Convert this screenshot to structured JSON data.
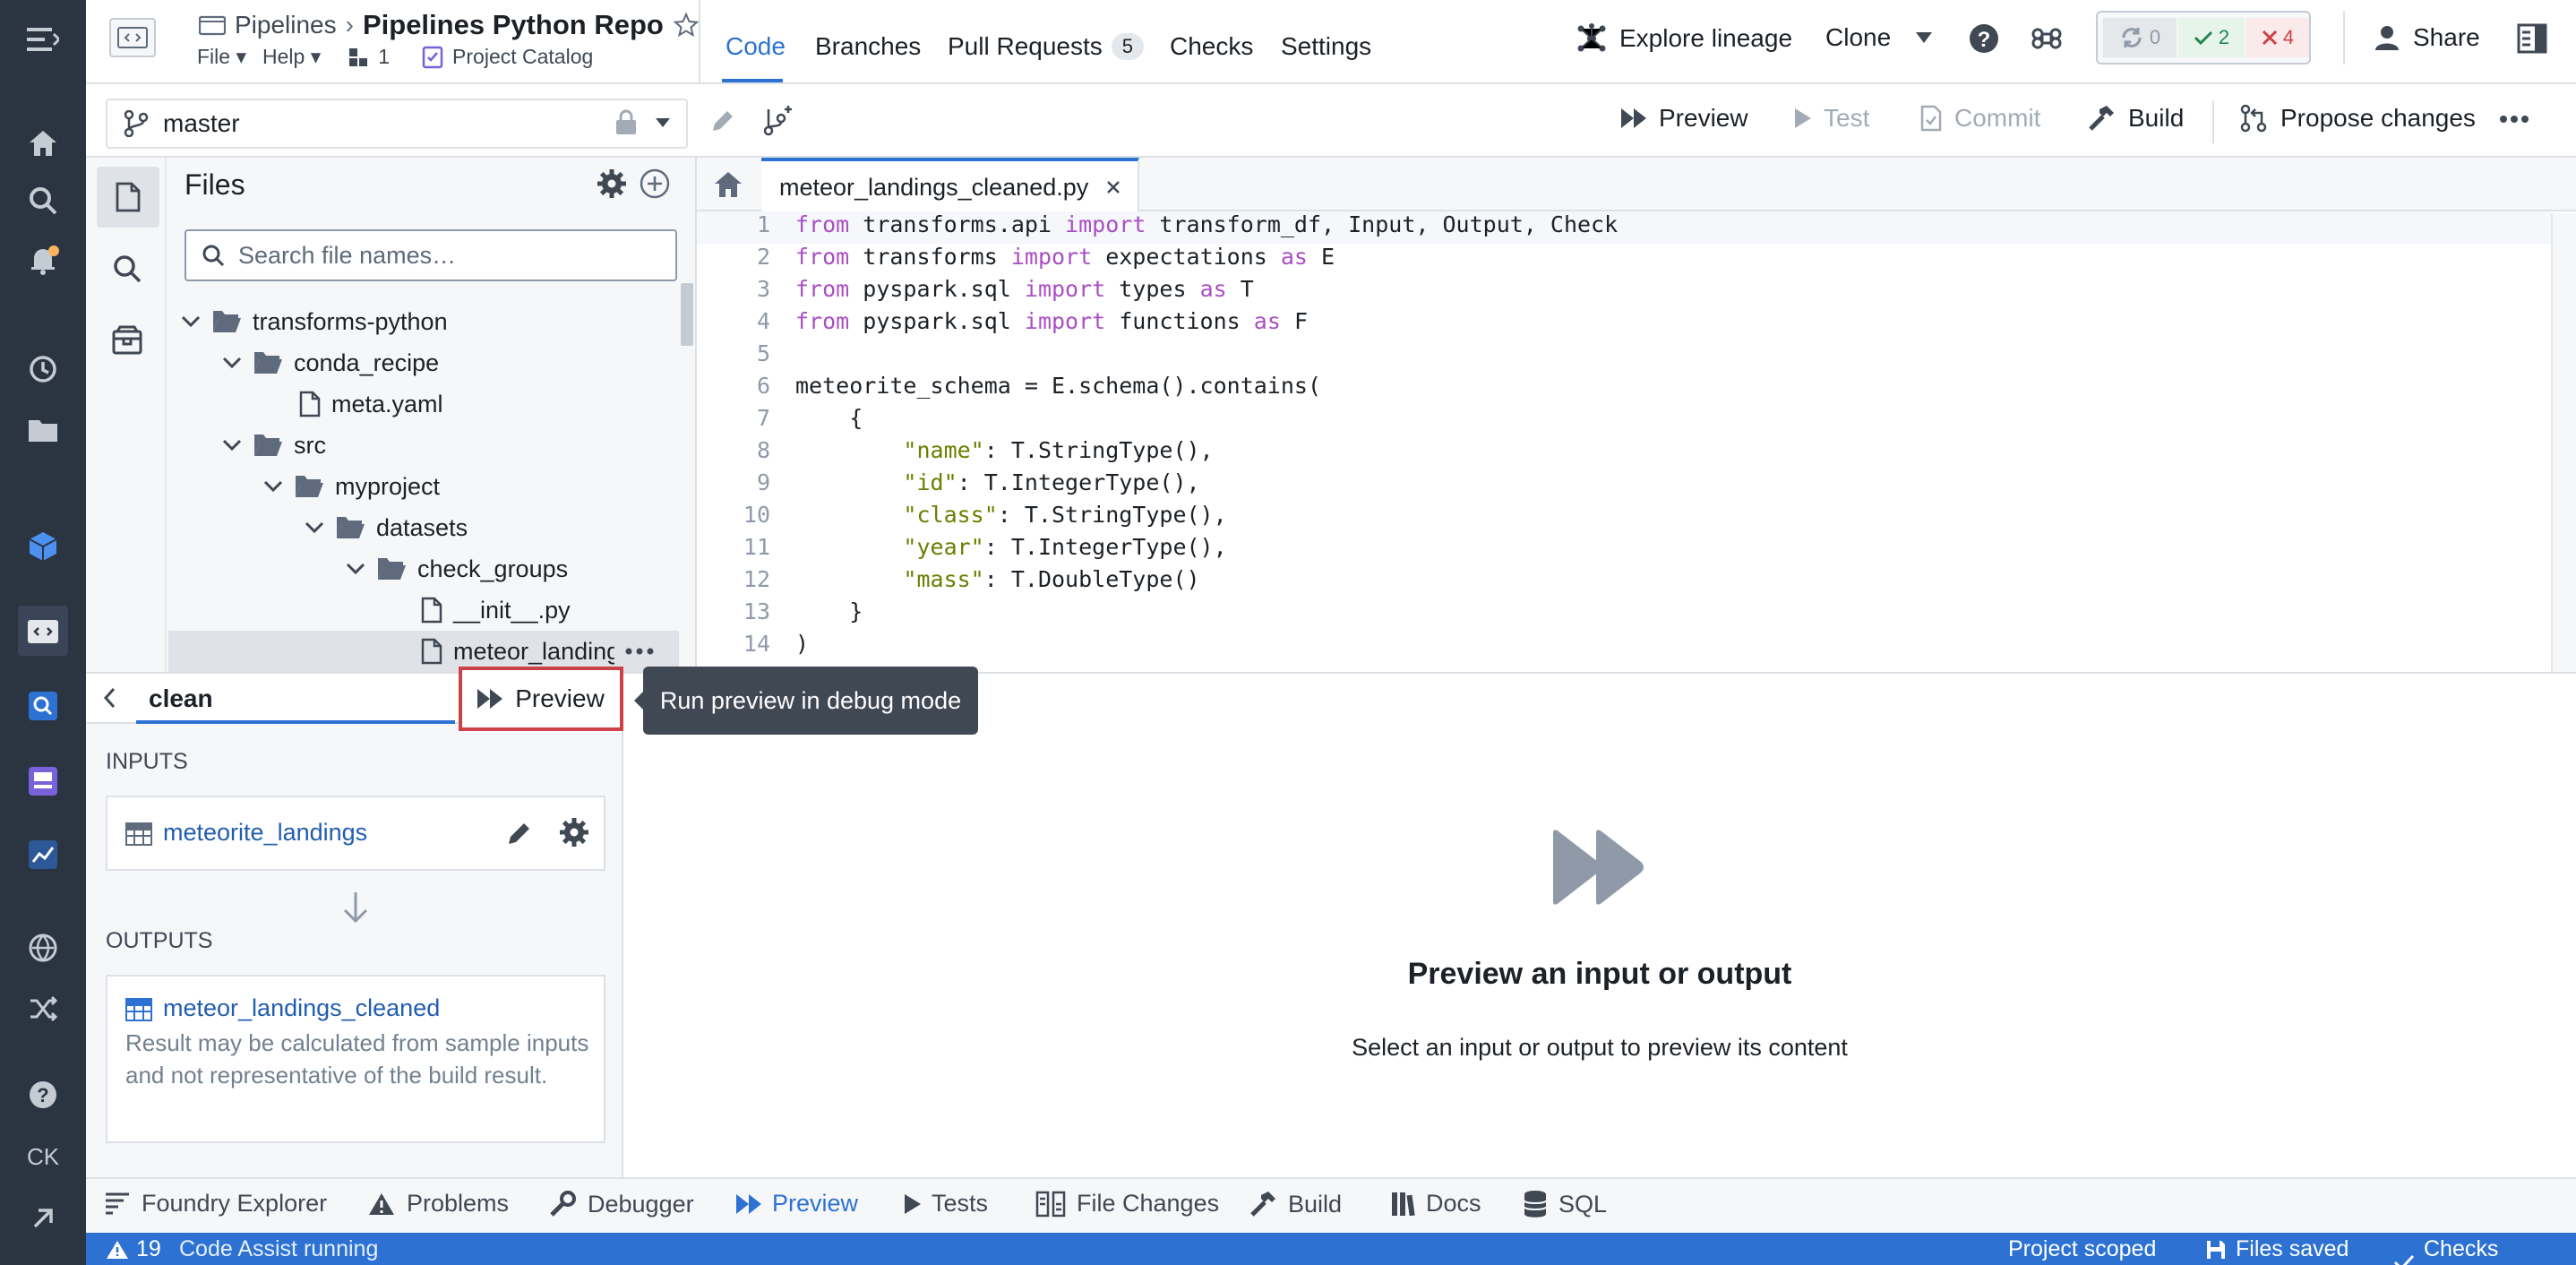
{
  "rail": {
    "user_initials": "CK",
    "alert_count": "19"
  },
  "header": {
    "breadcrumb_parent": "Pipelines",
    "repo_title": "Pipelines Python Repo",
    "menu_file": "File",
    "menu_help": "Help",
    "branch_count": "1",
    "project_link": "Project Catalog",
    "tabs": [
      {
        "label": "Code"
      },
      {
        "label": "Branches"
      },
      {
        "label": "Pull Requests"
      },
      {
        "label": "Checks"
      },
      {
        "label": "Settings"
      }
    ],
    "pr_count": "5",
    "explore_lineage": "Explore lineage",
    "clone": "Clone",
    "status_running": "0",
    "status_passed": "2",
    "status_failed": "4",
    "share": "Share"
  },
  "toolbar": {
    "branch": "master",
    "preview": "Preview",
    "test": "Test",
    "commit": "Commit",
    "build": "Build",
    "propose": "Propose changes"
  },
  "files": {
    "title": "Files",
    "search_placeholder": "Search file names…",
    "tree": [
      {
        "label": "transforms-python"
      },
      {
        "label": "conda_recipe"
      },
      {
        "label": "meta.yaml"
      },
      {
        "label": "src"
      },
      {
        "label": "myproject"
      },
      {
        "label": "datasets"
      },
      {
        "label": "check_groups"
      },
      {
        "label": "__init__.py"
      },
      {
        "label": "meteor_landing"
      }
    ]
  },
  "editor": {
    "tab_name": "meteor_landings_cleaned.py",
    "lines": [
      {
        "n": "1"
      },
      {
        "n": "2"
      },
      {
        "n": "3"
      },
      {
        "n": "4"
      },
      {
        "n": "5"
      },
      {
        "n": "6"
      },
      {
        "n": "7"
      },
      {
        "n": "8"
      },
      {
        "n": "9"
      },
      {
        "n": "10"
      },
      {
        "n": "11"
      },
      {
        "n": "12"
      },
      {
        "n": "13"
      },
      {
        "n": "14"
      }
    ],
    "code": {
      "l1a": "from",
      "l1b": " transforms.api ",
      "l1c": "import",
      "l1d": " transform_df, Input, Output, Check",
      "l2a": "from",
      "l2b": " transforms ",
      "l2c": "import",
      "l2d": " expectations ",
      "l2e": "as",
      "l2f": " E",
      "l3a": "from",
      "l3b": " pyspark.sql ",
      "l3c": "import",
      "l3d": " types ",
      "l3e": "as",
      "l3f": " T",
      "l4a": "from",
      "l4b": " pyspark.sql ",
      "l4c": "import",
      "l4d": " functions ",
      "l4e": "as",
      "l4f": " F",
      "l6": "meteorite_schema = E.schema().contains(",
      "l7": "    {",
      "l8a": "        ",
      "l8b": "\"name\"",
      "l8c": ": T.StringType(),",
      "l9a": "        ",
      "l9b": "\"id\"",
      "l9c": ": T.IntegerType(),",
      "l10a": "        ",
      "l10b": "\"class\"",
      "l10c": ": T.StringType(),",
      "l11a": "        ",
      "l11b": "\"year\"",
      "l11c": ": T.IntegerType(),",
      "l12a": "        ",
      "l12b": "\"mass\"",
      "l12c": ": T.DoubleType()",
      "l13": "    }",
      "l14": ")"
    }
  },
  "build_panel": {
    "transform_name": "clean",
    "preview_button": "Preview",
    "tooltip": "Run preview in debug mode",
    "inputs_label": "INPUTS",
    "input_dataset": "meteorite_landings",
    "outputs_label": "OUTPUTS",
    "output_dataset": "meteor_landings_cleaned",
    "output_note": "Result may be calculated from sample inputs and not representative of the build result."
  },
  "preview": {
    "title": "Preview an input or output",
    "subtitle": "Select an input or output to preview its content"
  },
  "bottom_tabs": [
    {
      "label": "Foundry Explorer"
    },
    {
      "label": "Problems"
    },
    {
      "label": "Debugger"
    },
    {
      "label": "Preview"
    },
    {
      "label": "Tests"
    },
    {
      "label": "File Changes"
    },
    {
      "label": "Build"
    },
    {
      "label": "Docs"
    },
    {
      "label": "SQL"
    }
  ],
  "status": {
    "code_assist": "Code Assist running",
    "scope": "Project scoped",
    "files_saved": "Files saved",
    "checks": "Checks passed"
  },
  "colors": {
    "accent": "#2d72d2",
    "rail": "#2b3441",
    "highlight_box": "#cd4246"
  }
}
